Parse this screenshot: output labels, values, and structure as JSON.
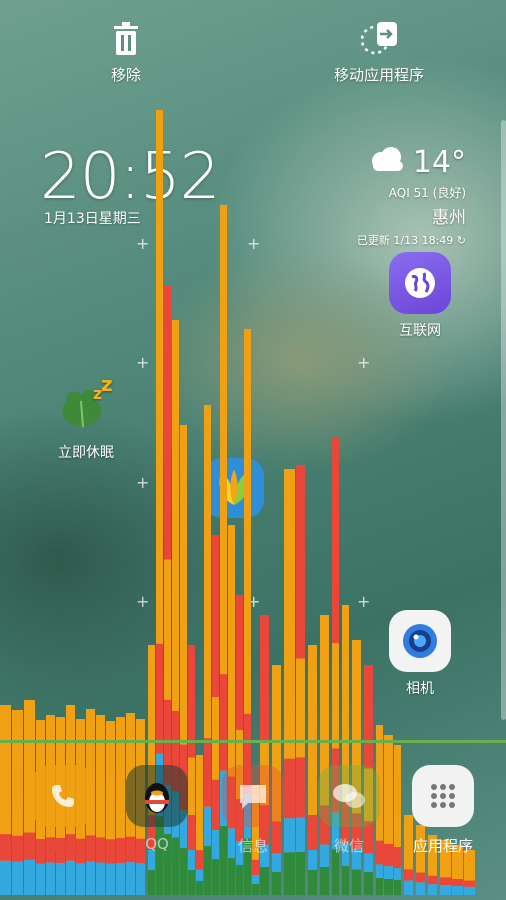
{
  "top_bar": {
    "remove_label": "移除",
    "move_apps_label": "移动应用程序"
  },
  "clock": {
    "time": "20:52",
    "date": "1月13日星期三"
  },
  "weather": {
    "temperature": "14°",
    "aqi": "AQI 51 (良好)",
    "city": "惠州",
    "updated": "已更新 1/13 18:49"
  },
  "apps": {
    "internet": "互联网",
    "sleep": "立即休眠",
    "camera": "相机"
  },
  "dock": {
    "phone": "电话",
    "qq": "QQ",
    "messages": "信息",
    "wechat": "微信",
    "apps": "应用程序"
  },
  "colors": {
    "bar_orange": "#f0a013",
    "bar_red": "#e8473a",
    "bar_blue": "#34a8e0",
    "bar_green": "#2f8a3b",
    "dock_line": "#67b04b"
  }
}
